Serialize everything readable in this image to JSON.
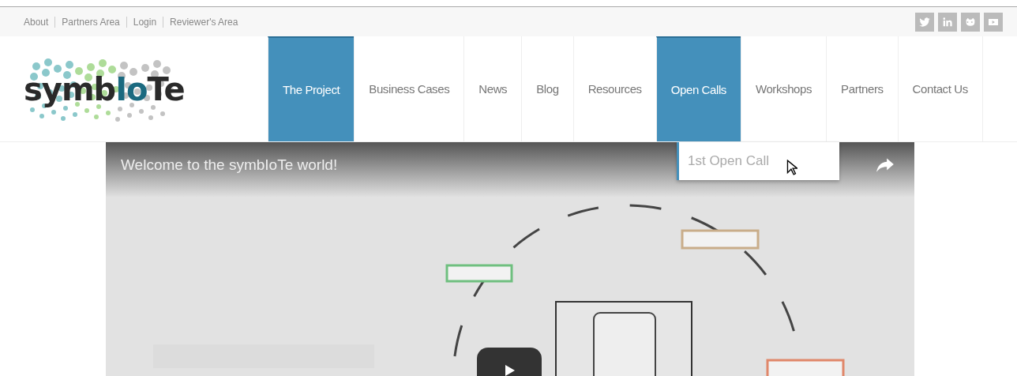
{
  "top_links": [
    "About",
    "Partners Area",
    "Login",
    "Reviewer's Area"
  ],
  "logo": {
    "parts": [
      "symb",
      "Io",
      "Te"
    ]
  },
  "nav": [
    {
      "label": "The Project",
      "selected": true
    },
    {
      "label": "Business Cases",
      "selected": false
    },
    {
      "label": "News",
      "selected": false
    },
    {
      "label": "Blog",
      "selected": false
    },
    {
      "label": "Resources",
      "selected": false
    },
    {
      "label": "Open Calls",
      "selected": true
    },
    {
      "label": "Workshops",
      "selected": false
    },
    {
      "label": "Partners",
      "selected": false
    },
    {
      "label": "Contact Us",
      "selected": false
    }
  ],
  "dropdown": {
    "items": [
      "1st Open Call"
    ]
  },
  "video": {
    "title": "Welcome to the symbIoTe world!"
  }
}
